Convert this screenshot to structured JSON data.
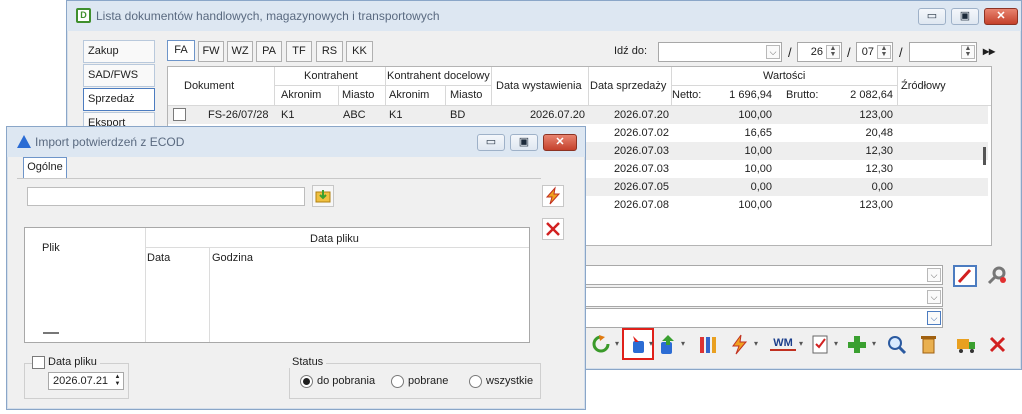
{
  "main_window": {
    "title": "Lista dokumentów handlowych, magazynowych i transportowych",
    "controls": {
      "minimize": "▭",
      "maximize": "▣",
      "close": "✕"
    },
    "side_nav": [
      {
        "label": "Zakup",
        "active": false
      },
      {
        "label": "SAD/FWS",
        "active": false
      },
      {
        "label": "Sprzedaż",
        "active": true
      },
      {
        "label": "Eksport",
        "active": false
      }
    ],
    "tabs": [
      {
        "label": "FA",
        "active": true
      },
      {
        "label": "FW"
      },
      {
        "label": "WZ"
      },
      {
        "label": "PA"
      },
      {
        "label": "TF"
      },
      {
        "label": "RS"
      },
      {
        "label": "KK"
      }
    ],
    "idz_do": {
      "label": "Idź do:",
      "sep1": "/",
      "day": "26",
      "sep2": "/",
      "month": "07",
      "sep3": "/",
      "nav": "▸▸"
    },
    "grid": {
      "headers": {
        "dokument": "Dokument",
        "kontrahent": "Kontrahent",
        "akronim": "Akronim",
        "miasto": "Miasto",
        "kontrahent_docelowy": "Kontrahent docelowy",
        "akronim2": "Akronim",
        "miasto2": "Miasto",
        "data_wystawienia": "Data wystawienia",
        "data_sprzedazy": "Data sprzedaży",
        "wartosci": "Wartości",
        "netto_label": "Netto:",
        "netto_total": "1 696,94",
        "brutto_label": "Brutto:",
        "brutto_total": "2 082,64",
        "zrodlowy": "Źródłowy"
      },
      "rows": [
        {
          "dokument": "FS-26/07/28",
          "akronim": "K1",
          "miasto": "ABC",
          "akronim2": "K1",
          "miasto2": "BD",
          "data_wyst": "2026.07.20",
          "data_sprz": "2026.07.20",
          "netto": "100,00",
          "brutto": "123,00"
        },
        {
          "dokument": "",
          "akronim": "",
          "miasto": "",
          "akronim2": "",
          "miasto2": "",
          "data_wyst": "",
          "data_sprz": "2026.07.02",
          "netto": "16,65",
          "brutto": "20,48"
        },
        {
          "dokument": "",
          "akronim": "",
          "miasto": "",
          "akronim2": "",
          "miasto2": "",
          "data_wyst": "",
          "data_sprz": "2026.07.03",
          "netto": "10,00",
          "brutto": "12,30"
        },
        {
          "dokument": "",
          "akronim": "",
          "miasto": "",
          "akronim2": "",
          "miasto2": "",
          "data_wyst": "",
          "data_sprz": "2026.07.03",
          "netto": "10,00",
          "brutto": "12,30"
        },
        {
          "dokument": "",
          "akronim": "",
          "miasto": "",
          "akronim2": "",
          "miasto2": "",
          "data_wyst": "",
          "data_sprz": "2026.07.05",
          "netto": "0,00",
          "brutto": "0,00"
        },
        {
          "dokument": "",
          "akronim": "",
          "miasto": "",
          "akronim2": "",
          "miasto2": "",
          "data_wyst": "",
          "data_sprz": "2026.07.08",
          "netto": "100,00",
          "brutto": "123,00"
        }
      ]
    },
    "toolbar_icons": [
      "refresh-icon",
      "import-ecod-icon",
      "export-icon",
      "columns-icon",
      "lightning-icon",
      "wm-icon",
      "checklist-icon",
      "add-icon",
      "search-icon",
      "delete-trash-icon",
      "truck-icon",
      "close-x-icon"
    ],
    "wm_text": "WM"
  },
  "dialog": {
    "title": "Import potwierdzeń z ECOD",
    "controls": {
      "minimize": "▭",
      "maximize": "▣",
      "close": "✕"
    },
    "tab": "Ogólne",
    "file_path": "",
    "table": {
      "col_plik": "Plik",
      "col_data_pliku": "Data pliku",
      "col_data": "Data",
      "col_godzina": "Godzina"
    },
    "data_pliku": {
      "label": "Data pliku",
      "checked": false,
      "value": "2026.07.21"
    },
    "status": {
      "label": "Status",
      "options": [
        {
          "label": "do pobrania",
          "selected": true
        },
        {
          "label": "pobrane",
          "selected": false
        },
        {
          "label": "wszystkie",
          "selected": false
        }
      ]
    }
  },
  "colors": {
    "title_bar": "#dde7f2",
    "accent_blue": "#4c7cc0",
    "close_red": "#c4412c",
    "highlight_red": "#e0201a"
  }
}
